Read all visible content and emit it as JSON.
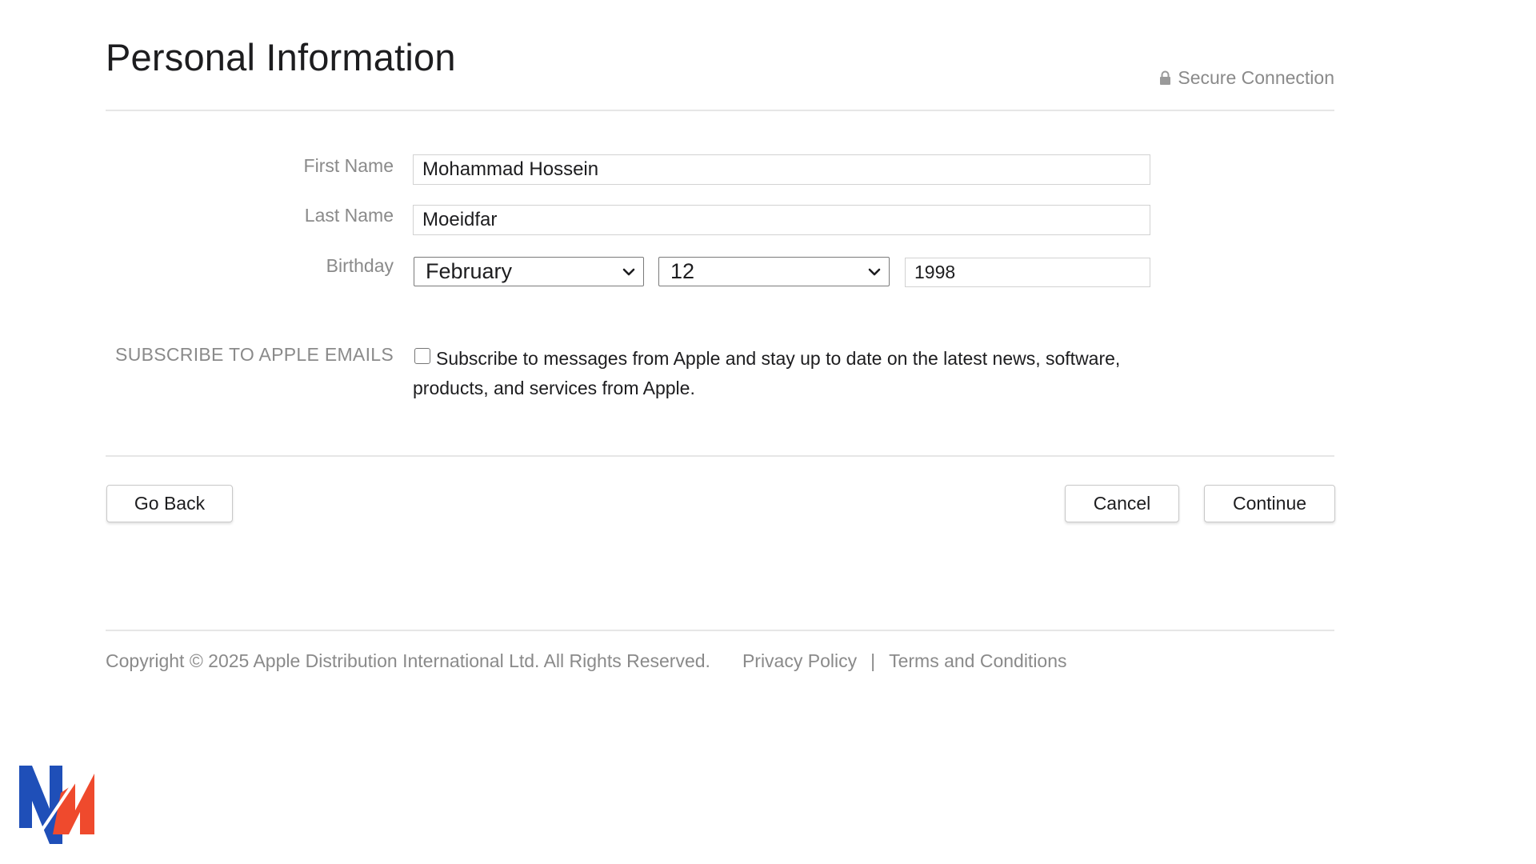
{
  "header": {
    "title": "Personal Information",
    "secure_label": "Secure Connection"
  },
  "form": {
    "first_name": {
      "label": "First Name",
      "value": "Mohammad Hossein"
    },
    "last_name": {
      "label": "Last Name",
      "value": "Moeidfar"
    },
    "birthday": {
      "label": "Birthday",
      "month": "February",
      "day": "12",
      "year": "1998"
    },
    "subscribe": {
      "label": "SUBSCRIBE TO APPLE EMAILS",
      "text": "Subscribe to messages from Apple and stay up to date on the latest news, software, products, and services from Apple.",
      "checked": false
    }
  },
  "actions": {
    "go_back": "Go Back",
    "cancel": "Cancel",
    "continue": "Continue"
  },
  "footer": {
    "copyright": "Copyright © 2025 Apple Distribution International Ltd. All Rights Reserved.",
    "privacy": "Privacy Policy",
    "separator": "|",
    "terms": "Terms and Conditions"
  },
  "icons": {
    "lock": "lock-icon",
    "chevron": "chevron-down-icon",
    "logo": "nm-logo"
  },
  "colors": {
    "logo_blue": "#1f4fb8",
    "logo_red": "#ef4a2d"
  }
}
